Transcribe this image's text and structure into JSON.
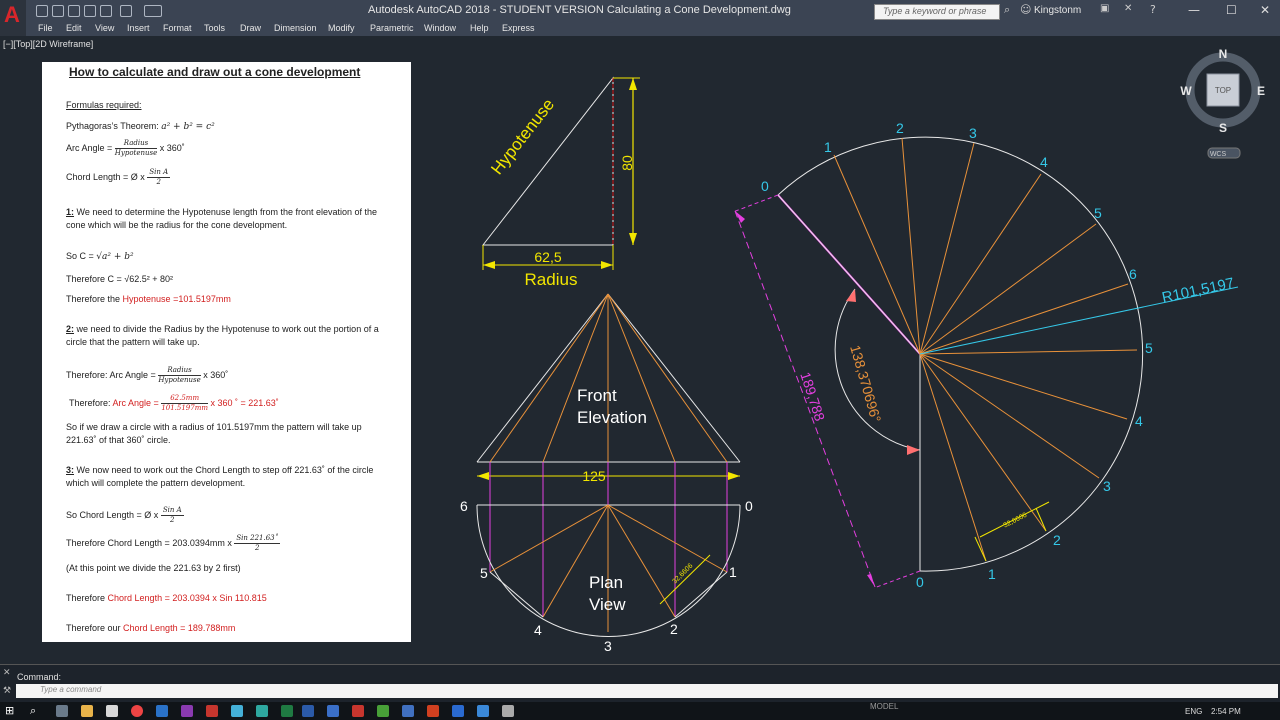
{
  "titlebar": {
    "app_letter": "A",
    "title": "Autodesk AutoCAD 2018 - STUDENT VERSION    Calculating a Cone Development.dwg",
    "search_placeholder": "Type a keyword or phrase",
    "user": "Kingstonm",
    "minimize": "—",
    "maximize": "☐",
    "close": "✕"
  },
  "menu": [
    "File",
    "Edit",
    "View",
    "Insert",
    "Format",
    "Tools",
    "Draw",
    "Dimension",
    "Modify",
    "Parametric",
    "Window",
    "Help",
    "Express"
  ],
  "viewport_label": "[−][Top][2D Wireframe]",
  "viewcube": {
    "n": "N",
    "s": "S",
    "e": "E",
    "w": "W",
    "top": "TOP",
    "wcs": "WCS"
  },
  "doc": {
    "title": "How to calculate and draw out a cone development",
    "formulas_heading": "Formulas required:",
    "pythagoras_label": "Pythagoras’s Theorem: ",
    "pythagoras_formula": "a² + b² = c²",
    "arc_angle_label": "Arc Angle = ",
    "arc_num": "Radius",
    "arc_den": "Hypotenuse",
    "arc_tail": " x 360˚",
    "chord_label": "Chord Length = Ø x ",
    "chord_num": "Sin A",
    "chord_den": "2",
    "step1_num": "1:",
    "step1_line1": " We need to determine the Hypotenuse length from the front elevation of the",
    "step1_line2": "cone which will be the radius for the cone development.",
    "soc_label": "So C = ",
    "soc_formula": "√a² + b²",
    "therefore_c": "Therefore C = √62.5² + 80²",
    "therefore_hyp_label": "Therefore the ",
    "therefore_hyp_value": "Hypotenuse =101.5197mm",
    "step2_num": "2:",
    "step2_line1": " we need to divide the Radius by the Hypotenuse to work out the portion of a",
    "step2_line2": "circle that the pattern will take up.",
    "th_arc_label": "Therefore: Arc Angle = ",
    "th_arc2_label": "Therefore: ",
    "th_arc2_red": "Arc Angle = ",
    "th_arc2_num": "62.5mm",
    "th_arc2_den": "101.5197mm",
    "th_arc2_tail": " x 360 ˚ = 221.63˚",
    "so_line1": "So if we draw a circle with a radius of 101.5197mm the pattern will take up",
    "so_line2": "221.63˚ of that 360˚ circle.",
    "step3_num": "3:",
    "step3_line1": " We now need to work out the Chord Length to step off 221.63˚ of the circle",
    "step3_line2": "which will complete the pattern development.",
    "so_chord_label": "So Chord Length = Ø x ",
    "th_chord_label": "Therefore  Chord Length = 203.0394mm x ",
    "th_chord_num": "Sin 221.63˚",
    "at_point": "(At this point we divide the 221.63 by 2 first)",
    "th_chord2_label": "Therefore ",
    "th_chord2_red": "Chord Length = 203.0394 x Sin 110.815",
    "th_our_label": "Therefore our ",
    "th_our_red": "Chord Length = 189.788mm"
  },
  "drawing": {
    "hypotenuse": "Hypotenuse",
    "dim_80": "80",
    "dim_radius_value": "62,5",
    "radius": "Radius",
    "front_line1": "Front",
    "front_line2": "Elevation",
    "dim_125": "125",
    "plan_line1": "Plan",
    "plan_line2": "View",
    "plan_chord": "32,6606",
    "plan_nums": [
      "6",
      "0",
      "5",
      "1",
      "4",
      "2",
      "3"
    ],
    "dev_nums_top": [
      "0",
      "1",
      "2",
      "3",
      "4",
      "5",
      "6"
    ],
    "dev_nums_bottom": [
      "5",
      "4",
      "3",
      "2",
      "1",
      "0"
    ],
    "dev_radius": "R101,5197",
    "dev_angle": "138,370696°",
    "dev_chord": "189,788",
    "dev_step_chord": "32,6606"
  },
  "command": {
    "history": "Command:",
    "placeholder": "Type a command"
  },
  "taskbar": {
    "model": "MODEL",
    "lang": "ENG",
    "time": "2:54 PM"
  },
  "colors": {
    "canvas": "#212830",
    "cyan": "#35c8e8",
    "orange": "#e8913a",
    "magenta": "#e43fe0",
    "yellow": "#f2e600",
    "white_line": "#e8e8e8",
    "red_arrow": "#ff7070",
    "doc_red": "#d21f1f"
  }
}
